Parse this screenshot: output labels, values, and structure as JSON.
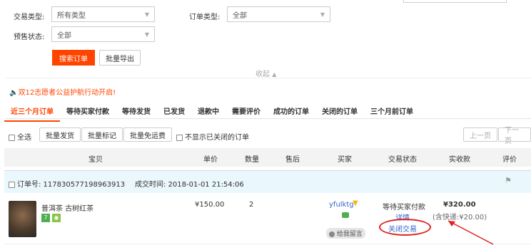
{
  "filters": {
    "trade_type_label": "交易类型:",
    "trade_type_value": "所有类型",
    "order_type_label": "订单类型:",
    "order_type_value": "全部",
    "presale_label": "预售状态:",
    "presale_value": "全部",
    "search_btn": "搜索订单",
    "export_btn": "批量导出",
    "collapse": "收起"
  },
  "notice": "双12志愿者公益护航行动开启!",
  "tabs": [
    "近三个月订单",
    "等待买家付款",
    "等待发货",
    "已发货",
    "退款中",
    "需要评价",
    "成功的订单",
    "关闭的订单",
    "三个月前订单"
  ],
  "actions": {
    "select_all": "全选",
    "batch_ship": "批量发货",
    "batch_mark": "批量标记",
    "batch_free_shipping": "批量免运费",
    "hide_closed": "不显示已关闭的订单",
    "prev_page": "上一页",
    "next_page": "下一页"
  },
  "columns": [
    "宝贝",
    "单价",
    "数量",
    "售后",
    "买家",
    "交易状态",
    "实收款",
    "评价"
  ],
  "order": {
    "number_label": "订单号: 117830577198963913",
    "time_label": "成交时间: 2018-01-01 21:54:06",
    "item_name": "普洱茶 古树红茶",
    "unit_price": "¥150.00",
    "quantity": "2",
    "buyer": "yfulktg",
    "leave_msg": "给我留言",
    "status": "等待买家付款",
    "detail": "详情",
    "close_trade": "关闭交易",
    "total": "¥320.00",
    "shipping": "(含快递:¥20.00)"
  },
  "colors": {
    "accent": "#ff4400",
    "link": "#3366cc",
    "annotation": "#e02020"
  }
}
